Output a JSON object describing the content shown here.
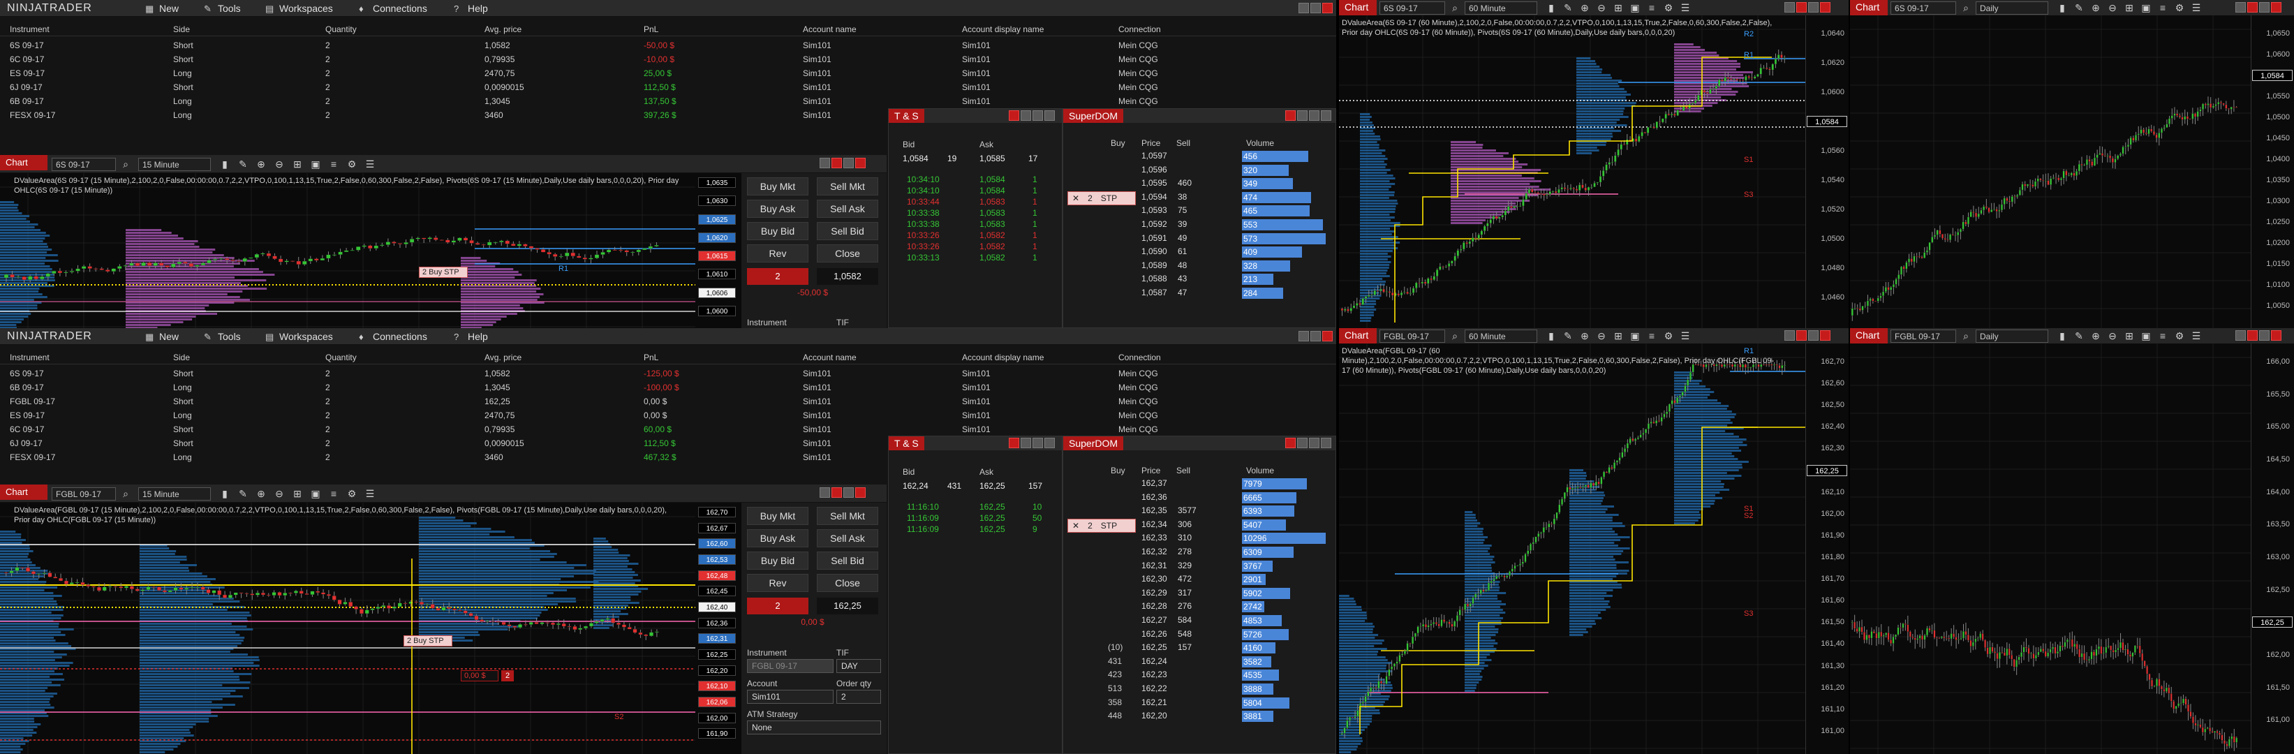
{
  "app": {
    "logo": "NINJATRADER",
    "menu": [
      {
        "label": "New",
        "icon": "grid-icon"
      },
      {
        "label": "Tools",
        "icon": "tools-icon"
      },
      {
        "label": "Workspaces",
        "icon": "layers-icon"
      },
      {
        "label": "Connections",
        "icon": "bulb-icon"
      },
      {
        "label": "Help",
        "icon": "help-icon"
      }
    ]
  },
  "positions": {
    "headers": [
      "Instrument",
      "Side",
      "Quantity",
      "Avg. price",
      "PnL",
      "Account name",
      "Account display name",
      "Connection"
    ],
    "top_rows": [
      [
        "6S 09-17",
        "Short",
        "2",
        "1,0582",
        "-50,00 $",
        "Sim101",
        "Sim101",
        "Mein CQG"
      ],
      [
        "6C 09-17",
        "Short",
        "2",
        "0,79935",
        "-10,00 $",
        "Sim101",
        "Sim101",
        "Mein CQG"
      ],
      [
        "ES 09-17",
        "Long",
        "2",
        "2470,75",
        "25,00 $",
        "Sim101",
        "Sim101",
        "Mein CQG"
      ],
      [
        "6J 09-17",
        "Short",
        "2",
        "0,0090015",
        "112,50 $",
        "Sim101",
        "Sim101",
        "Mein CQG"
      ],
      [
        "6B 09-17",
        "Long",
        "2",
        "1,3045",
        "137,50 $",
        "Sim101",
        "Sim101",
        "Mein CQG"
      ],
      [
        "FESX 09-17",
        "Long",
        "2",
        "3460",
        "397,26 $",
        "Sim101",
        "Sim101",
        "Mein CQG"
      ]
    ],
    "bottom_rows": [
      [
        "6S 09-17",
        "Short",
        "2",
        "1,0582",
        "-125,00 $",
        "Sim101",
        "Sim101",
        "Mein CQG"
      ],
      [
        "6B 09-17",
        "Long",
        "2",
        "1,3045",
        "-100,00 $",
        "Sim101",
        "Sim101",
        "Mein CQG"
      ],
      [
        "FGBL 09-17",
        "Short",
        "2",
        "162,25",
        "0,00 $",
        "Sim101",
        "Sim101",
        "Mein CQG"
      ],
      [
        "ES 09-17",
        "Long",
        "2",
        "2470,75",
        "0,00 $",
        "Sim101",
        "Sim101",
        "Mein CQG"
      ],
      [
        "6C 09-17",
        "Short",
        "2",
        "0,79935",
        "60,00 $",
        "Sim101",
        "Sim101",
        "Mein CQG"
      ],
      [
        "6J 09-17",
        "Short",
        "2",
        "0,0090015",
        "112,50 $",
        "Sim101",
        "Sim101",
        "Mein CQG"
      ],
      [
        "FESX 09-17",
        "Long",
        "2",
        "3460",
        "467,32 $",
        "Sim101",
        "Sim101",
        "Mein CQG"
      ]
    ]
  },
  "top_chart": {
    "tab": "Chart",
    "instrument": "6S 09-17",
    "interval": "15 Minute",
    "indicator_text": "DValueArea(6S 09-17 (15 Minute),2,100,2,0,False,00:00:00,0.7,2,2,VTPO,0,100,1,13,15,True,2,False,0,60,300,False,2,False), Pivots(6S 09-17 (15 Minute),Daily,Use daily bars,0,0,0,20), Prior day OHLC(6S 09-17 (15 Minute))",
    "axis_ticks": [
      "1,0635",
      "1,0630",
      "1,0625",
      "1,0620",
      "1,0615",
      "1,0610",
      "1,0606",
      "1,0600"
    ],
    "order_label": "2 Buy STP"
  },
  "bottom_chart": {
    "tab": "Chart",
    "instrument": "FGBL 09-17",
    "interval": "15 Minute",
    "indicator_text": "DValueArea(FGBL 09-17 (15 Minute),2,100,2,0,False,00:00:00,0.7,2,2,VTPO,0,100,1,13,15,True,2,False,0,60,300,False,2,False), Pivots(FGBL 09-17 (15 Minute),Daily,Use daily bars,0,0,0,20), Prior day OHLC(FGBL 09-17 (15 Minute))",
    "axis_ticks": [
      "162,70",
      "162,67",
      "162,60",
      "162,53",
      "162,48",
      "162,45",
      "162,40",
      "162,36",
      "162,31",
      "162,25",
      "162,20",
      "162,10",
      "162,06",
      "162,00",
      "161,90"
    ],
    "order_label": "2 Buy STP",
    "pnl_tag": "0,00 $",
    "qty_tag": "2"
  },
  "chart_trader_top": {
    "buttons": [
      "Buy Mkt",
      "Sell Mkt",
      "Buy Ask",
      "Sell Ask",
      "Buy Bid",
      "Sell Bid",
      "Rev",
      "Close"
    ],
    "qty": "2",
    "price": "1,0582",
    "pnl": "-50,00 $",
    "instrument_label": "Instrument",
    "tif_label": "TIF"
  },
  "chart_trader_bottom": {
    "buttons": [
      "Buy Mkt",
      "Sell Mkt",
      "Buy Ask",
      "Sell Ask",
      "Buy Bid",
      "Sell Bid",
      "Rev",
      "Close"
    ],
    "qty": "2",
    "price": "162,25",
    "pnl": "0,00 $",
    "instrument_label": "Instrument",
    "tif_label": "TIF",
    "instrument_value": "FGBL 09-17",
    "tif_value": "DAY",
    "account_label": "Account",
    "account_value": "Sim101",
    "order_qty_label": "Order qty",
    "order_qty_value": "2",
    "atm_label": "ATM Strategy",
    "atm_value": "None"
  },
  "ts_top": {
    "title": "T & S",
    "bid_label": "Bid",
    "ask_label": "Ask",
    "bid": "1,0584",
    "bid_size": "19",
    "ask": "1,0585",
    "ask_size": "17",
    "rows": [
      [
        "10:34:10",
        "1,0584",
        "1",
        "g"
      ],
      [
        "10:34:10",
        "1,0584",
        "1",
        "g"
      ],
      [
        "10:33:44",
        "1,0583",
        "1",
        "r"
      ],
      [
        "10:33:38",
        "1,0583",
        "1",
        "g"
      ],
      [
        "10:33:38",
        "1,0583",
        "1",
        "g"
      ],
      [
        "10:33:26",
        "1,0582",
        "1",
        "r"
      ],
      [
        "10:33:26",
        "1,0582",
        "1",
        "r"
      ],
      [
        "10:33:13",
        "1,0582",
        "1",
        "g"
      ]
    ]
  },
  "ts_bottom": {
    "title": "T & S",
    "bid_label": "Bid",
    "ask_label": "Ask",
    "bid": "162,24",
    "bid_size": "431",
    "ask": "162,25",
    "ask_size": "157",
    "rows": [
      [
        "11:16:10",
        "162,25",
        "10",
        "g"
      ],
      [
        "11:16:09",
        "162,25",
        "50",
        "g"
      ],
      [
        "11:16:09",
        "162,25",
        "9",
        "g"
      ]
    ]
  },
  "dom_top": {
    "title": "SuperDOM",
    "headers": [
      "Buy",
      "Price",
      "Sell",
      "Volume"
    ],
    "order": "2",
    "order_type": "STP",
    "rows": [
      [
        "",
        "1,0597",
        "",
        "456"
      ],
      [
        "",
        "1,0596",
        "",
        "320"
      ],
      [
        "",
        "1,0595",
        "460",
        "349"
      ],
      [
        "",
        "1,0594",
        "38",
        "474"
      ],
      [
        "",
        "1,0593",
        "75",
        "465"
      ],
      [
        "",
        "1,0592",
        "39",
        "553"
      ],
      [
        "",
        "1,0591",
        "49",
        "573"
      ],
      [
        "",
        "1,0590",
        "61",
        "409"
      ],
      [
        "",
        "1,0589",
        "48",
        "328"
      ],
      [
        "",
        "1,0588",
        "43",
        "213"
      ],
      [
        "",
        "1,0587",
        "47",
        "284"
      ]
    ]
  },
  "dom_bottom": {
    "title": "SuperDOM",
    "headers": [
      "Buy",
      "Price",
      "Sell",
      "Volume"
    ],
    "order": "2",
    "order_type": "STP",
    "rows": [
      [
        "",
        "162,37",
        "",
        "7979"
      ],
      [
        "",
        "162,36",
        "",
        "6665"
      ],
      [
        "",
        "162,35",
        "3577",
        "6393"
      ],
      [
        "",
        "162,34",
        "306",
        "5407"
      ],
      [
        "",
        "162,33",
        "310",
        "10296"
      ],
      [
        "",
        "162,32",
        "278",
        "6309"
      ],
      [
        "",
        "162,31",
        "329",
        "3767"
      ],
      [
        "",
        "162,30",
        "472",
        "2901"
      ],
      [
        "",
        "162,29",
        "317",
        "5902"
      ],
      [
        "",
        "162,28",
        "276",
        "2742"
      ],
      [
        "",
        "162,27",
        "584",
        "4853"
      ],
      [
        "",
        "162,26",
        "548",
        "5726"
      ],
      [
        "(10)",
        "162,25",
        "157",
        "4160"
      ],
      [
        "431",
        "162,24",
        "",
        "3582"
      ],
      [
        "423",
        "162,23",
        "",
        "4535"
      ],
      [
        "513",
        "162,22",
        "",
        "3888"
      ],
      [
        "358",
        "162,21",
        "",
        "5804"
      ],
      [
        "448",
        "162,20",
        "",
        "3881"
      ]
    ]
  },
  "right_top_chart": {
    "tab": "Chart",
    "instrument": "6S 09-17",
    "interval": "60 Minute",
    "indicator_text": "DValueArea(6S 09-17 (60 Minute),2,100,2,0,False,00:00:00,0.7,2,2,VTPO,0,100,1,13,15,True,2,False,0,60,300,False,2,False), Prior day OHLC(6S 09-17 (60 Minute)), Pivots(6S 09-17 (60 Minute),Daily,Use daily bars,0,0,0,20)",
    "axis_ticks": [
      "1,0640",
      "1,0620",
      "1,0600",
      "1,0584",
      "1,0560",
      "1,0540",
      "1,0520",
      "1,0500",
      "1,0480",
      "1,0460"
    ],
    "labels": [
      "R2",
      "R1",
      "S1",
      "S3"
    ],
    "last": "1,0584"
  },
  "right_bottom_chart": {
    "tab": "Chart",
    "instrument": "FGBL 09-17",
    "interval": "60 Minute",
    "indicator_text": "DValueArea(FGBL 09-17 (60 Minute),2,100,2,0,False,00:00:00,0.7,2,2,VTPO,0,100,1,13,15,True,2,False,0,60,300,False,2,False), Prior day OHLC(FGBL 09-17 (60 Minute)), Pivots(FGBL 09-17 (60 Minute),Daily,Use daily bars,0,0,0,20)",
    "axis_ticks": [
      "162,70",
      "162,60",
      "162,50",
      "162,40",
      "162,30",
      "162,25",
      "162,10",
      "162,00",
      "161,90",
      "161,80",
      "161,70",
      "161,60",
      "161,50",
      "161,40",
      "161,30",
      "161,20",
      "161,10",
      "161,00"
    ],
    "labels": [
      "R1",
      "S1",
      "S2",
      "S3"
    ],
    "last": "162,25"
  },
  "daily_top": {
    "tab": "Chart",
    "instrument": "6S 09-17",
    "interval": "Daily",
    "axis_ticks": [
      "1,0650",
      "1,0600",
      "1,0584",
      "1,0550",
      "1,0500",
      "1,0450",
      "1,0400",
      "1,0350",
      "1,0300",
      "1,0250",
      "1,0200",
      "1,0150",
      "1,0100",
      "1,0050"
    ],
    "last": "1,0584"
  },
  "daily_bottom": {
    "tab": "Chart",
    "instrument": "FGBL 09-17",
    "interval": "Daily",
    "axis_ticks": [
      "166,00",
      "165,50",
      "165,00",
      "164,50",
      "164,00",
      "163,50",
      "163,00",
      "162,50",
      "162,25",
      "162,00",
      "161,50",
      "161,00"
    ],
    "last": "162,25"
  },
  "colors": {
    "brand_red": "#b01818",
    "up": "#35c635",
    "down": "#e23030",
    "profile_blue": "#1f5f9a",
    "profile_violet": "#9a4fa6",
    "pivot_yellow": "#ffe500",
    "dom_bar": "#4a86d8"
  }
}
